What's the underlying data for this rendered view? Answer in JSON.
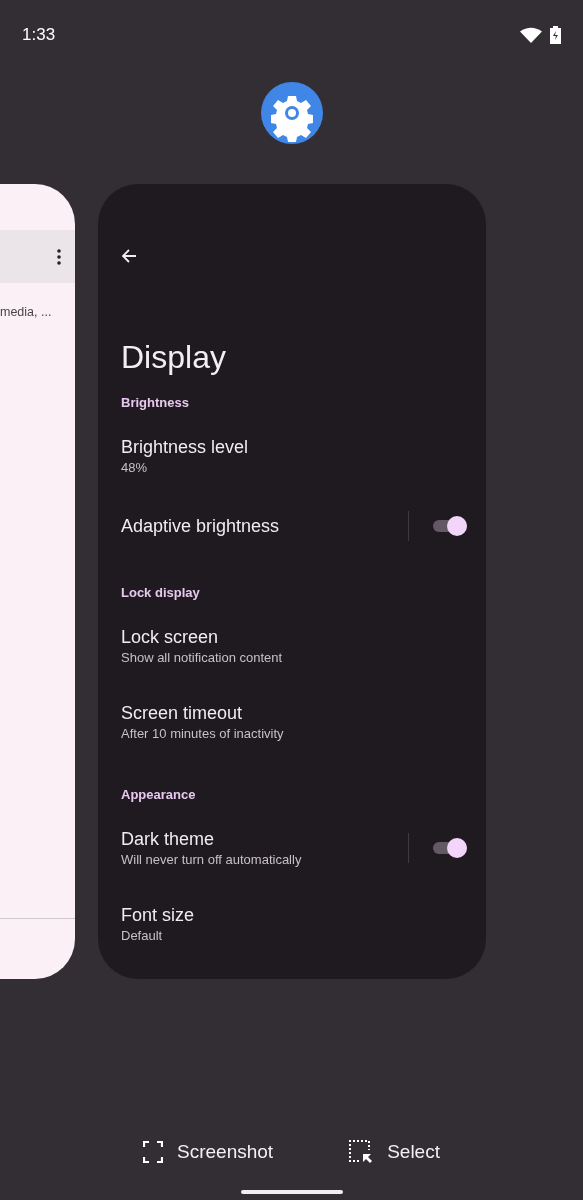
{
  "status_bar": {
    "time": "1:33"
  },
  "left_card": {
    "text": "media, ..."
  },
  "settings_card": {
    "title": "Display",
    "sections": [
      {
        "header": "Brightness",
        "items": [
          {
            "kind": "item",
            "title": "Brightness level",
            "summary": "48%"
          },
          {
            "kind": "toggle",
            "title": "Adaptive brightness",
            "on": true
          }
        ]
      },
      {
        "header": "Lock display",
        "items": [
          {
            "kind": "item",
            "title": "Lock screen",
            "summary": "Show all notification content"
          },
          {
            "kind": "item",
            "title": "Screen timeout",
            "summary": "After 10 minutes of inactivity"
          }
        ]
      },
      {
        "header": "Appearance",
        "items": [
          {
            "kind": "toggle",
            "title": "Dark theme",
            "summary": "Will never turn off automatically",
            "on": true
          },
          {
            "kind": "item",
            "title": "Font size",
            "summary": "Default"
          }
        ]
      }
    ]
  },
  "actions": [
    {
      "kind": "screenshot",
      "label": "Screenshot"
    },
    {
      "kind": "select",
      "label": "Select"
    }
  ]
}
